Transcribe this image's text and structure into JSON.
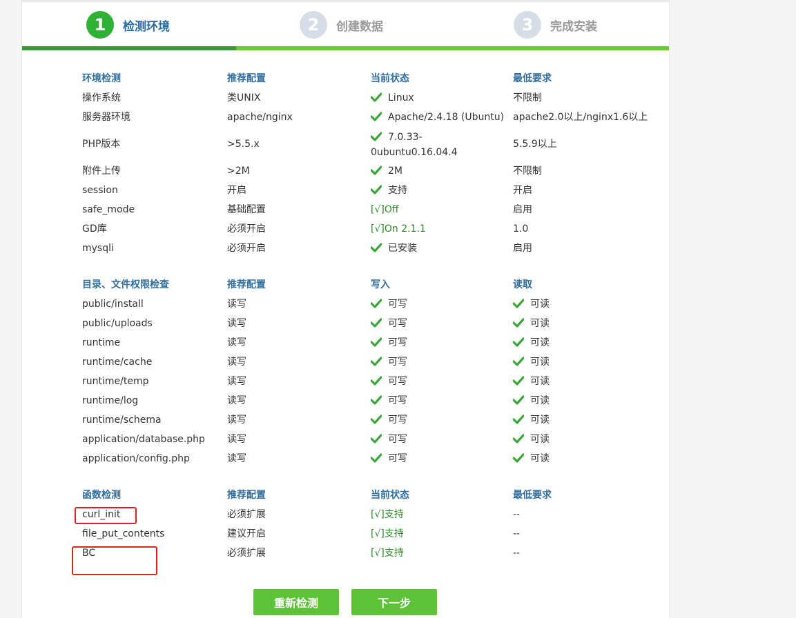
{
  "steps": [
    {
      "num": "1",
      "label": "检测环境"
    },
    {
      "num": "2",
      "label": "创建数据"
    },
    {
      "num": "3",
      "label": "完成安装"
    }
  ],
  "env": {
    "headers": [
      "环境检测",
      "推荐配置",
      "当前状态",
      "最低要求"
    ],
    "rows": [
      {
        "name": "操作系统",
        "rec": "类UNIX",
        "status": "Linux",
        "min": "不限制"
      },
      {
        "name": "服务器环境",
        "rec": "apache/nginx",
        "status": "Apache/2.4.18 (Ubuntu)",
        "min": "apache2.0以上/nginx1.6以上"
      },
      {
        "name": "PHP版本",
        "rec": ">5.5.x",
        "status": "7.0.33-0ubuntu0.16.04.4",
        "min": "5.5.9以上"
      },
      {
        "name": "附件上传",
        "rec": ">2M",
        "status": "2M",
        "min": "不限制"
      },
      {
        "name": "session",
        "rec": "开启",
        "status": "支持",
        "min": "开启"
      },
      {
        "name": "safe_mode",
        "rec": "基础配置",
        "status": "[√]Off",
        "min": "启用"
      },
      {
        "name": "GD库",
        "rec": "必须开启",
        "status": "[√]On 2.1.1",
        "min": "1.0"
      },
      {
        "name": "mysqli",
        "rec": "必须开启",
        "status": "已安装",
        "min": "启用"
      }
    ]
  },
  "dirs": {
    "headers": [
      "目录、文件权限检查",
      "推荐配置",
      "写入",
      "读取"
    ],
    "write_label": "可写",
    "read_label": "可读",
    "rows": [
      {
        "path": "public/install",
        "rec": "读写"
      },
      {
        "path": "public/uploads",
        "rec": "读写"
      },
      {
        "path": "runtime",
        "rec": "读写"
      },
      {
        "path": "runtime/cache",
        "rec": "读写"
      },
      {
        "path": "runtime/temp",
        "rec": "读写"
      },
      {
        "path": "runtime/log",
        "rec": "读写"
      },
      {
        "path": "runtime/schema",
        "rec": "读写"
      },
      {
        "path": "application/database.php",
        "rec": "读写"
      },
      {
        "path": "application/config.php",
        "rec": "读写"
      }
    ]
  },
  "funcs": {
    "headers": [
      "函数检测",
      "推荐配置",
      "当前状态",
      "最低要求"
    ],
    "rows": [
      {
        "name": "curl_init",
        "rec": "必须扩展",
        "status": "[√]支持",
        "min": "--"
      },
      {
        "name": "file_put_contents",
        "rec": "建议开启",
        "status": "[√]支持",
        "min": "--"
      },
      {
        "name": "BC",
        "rec": "必须扩展",
        "status": "[√]支持",
        "min": "--"
      }
    ]
  },
  "buttons": {
    "recheck": "重新检测",
    "next": "下一步"
  },
  "colors": {
    "accent": "#2eb135",
    "header_text": "#2f6e9f",
    "button": "#5ec238",
    "highlight_box": "#e0201a"
  }
}
